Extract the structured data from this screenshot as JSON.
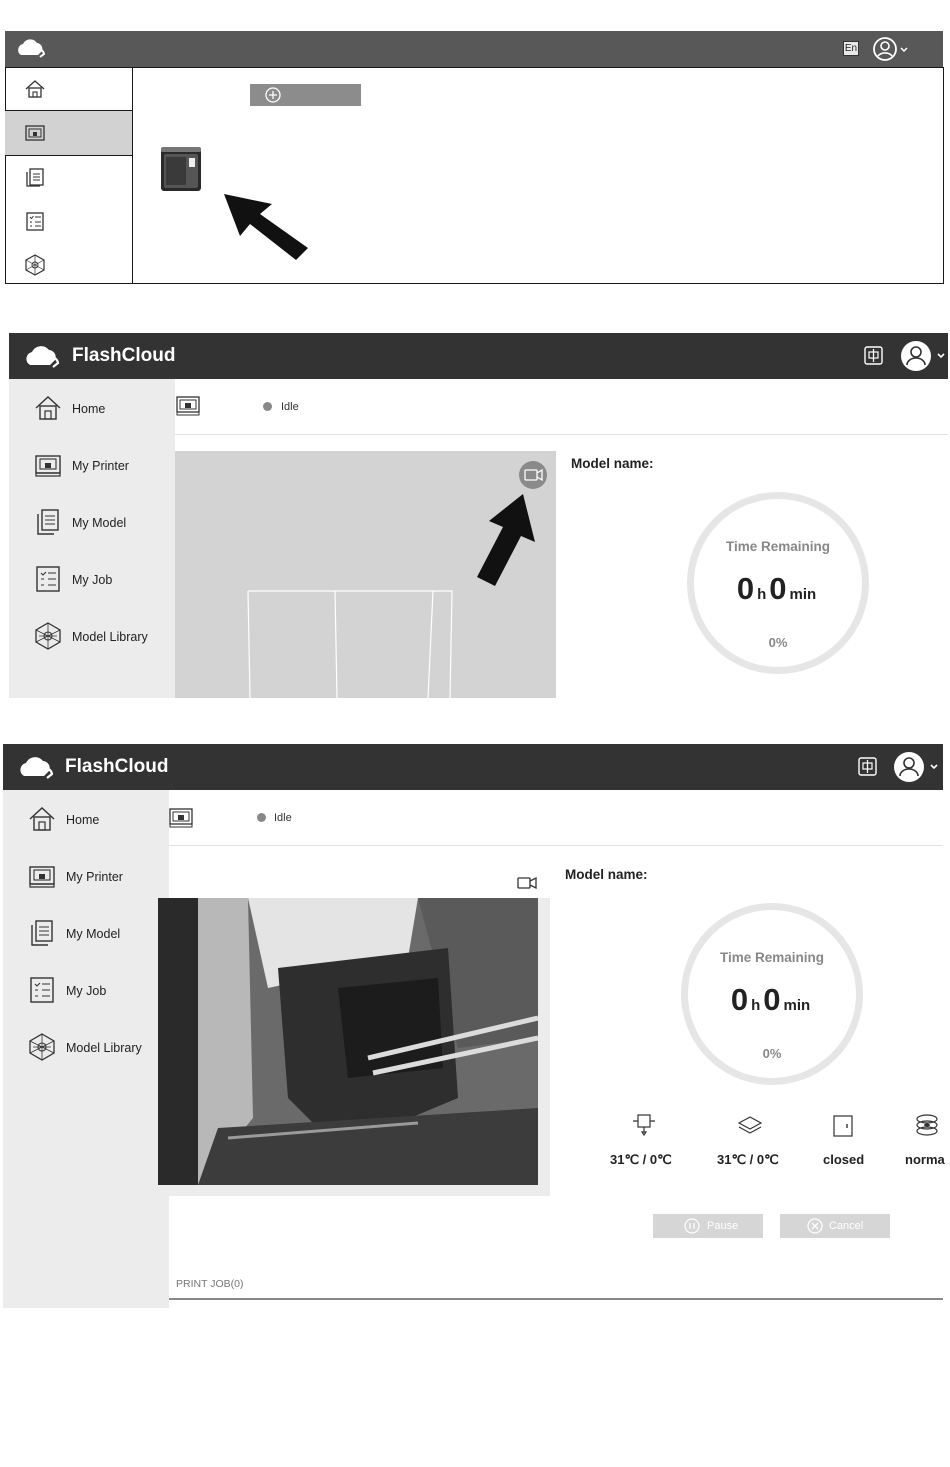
{
  "panel1": {
    "sidebar": {
      "items": [
        {
          "icon": "home-icon"
        },
        {
          "icon": "printer-icon",
          "selected": true
        },
        {
          "icon": "model-icon"
        },
        {
          "icon": "job-icon"
        },
        {
          "icon": "library-icon"
        }
      ]
    },
    "header": {
      "lang": "En",
      "user_icon": "user-icon"
    },
    "add_button_icon": "plus-circle-icon"
  },
  "panel2": {
    "app_title": "FlashCloud",
    "lang_icon": "chinese-lang-icon",
    "sidebar": {
      "items": [
        {
          "label": "Home",
          "icon": "home-icon"
        },
        {
          "label": "My Printer",
          "icon": "printer-icon"
        },
        {
          "label": "My Model",
          "icon": "model-icon"
        },
        {
          "label": "My Job",
          "icon": "job-icon"
        },
        {
          "label": "Model Library",
          "icon": "library-icon"
        }
      ]
    },
    "status": "Idle",
    "model_name_label": "Model name:",
    "progress": {
      "title": "Time Remaining",
      "hours": "0",
      "h_unit": "h",
      "minutes": "0",
      "min_unit": "min",
      "percent": "0%"
    }
  },
  "panel3": {
    "app_title": "FlashCloud",
    "sidebar": {
      "items": [
        {
          "label": "Home",
          "icon": "home-icon"
        },
        {
          "label": "My Printer",
          "icon": "printer-icon"
        },
        {
          "label": "My Model",
          "icon": "model-icon"
        },
        {
          "label": "My Job",
          "icon": "job-icon"
        },
        {
          "label": "Model Library",
          "icon": "library-icon"
        }
      ]
    },
    "status": "Idle",
    "model_name_label": "Model name:",
    "progress": {
      "title": "Time Remaining",
      "hours": "0",
      "h_unit": "h",
      "minutes": "0",
      "min_unit": "min",
      "percent": "0%"
    },
    "stats": [
      {
        "icon": "nozzle-icon",
        "value": "31℃ / 0℃"
      },
      {
        "icon": "platform-icon",
        "value": "31℃ / 0℃"
      },
      {
        "icon": "door-icon",
        "value": "closed"
      },
      {
        "icon": "filament-icon",
        "value": "norma"
      }
    ],
    "buttons": {
      "pause": "Pause",
      "cancel": "Cancel"
    },
    "print_jobs_label": "PRINT JOB(0)"
  },
  "colors": {
    "topbar_dark": "#333333",
    "sidebar_bg": "#ececec",
    "panel1_topbar": "#585858"
  }
}
